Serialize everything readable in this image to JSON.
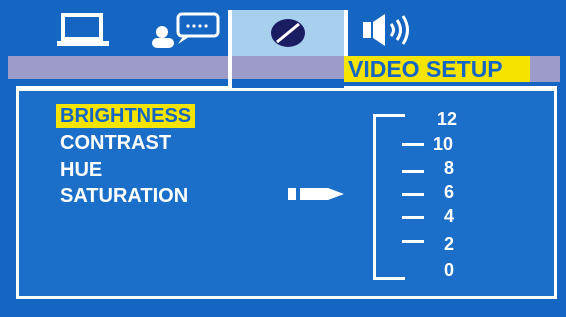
{
  "header": {
    "title": "VIDEO SETUP",
    "tabs": [
      {
        "icon": "monitor-icon"
      },
      {
        "icon": "user-chat-icon"
      },
      {
        "icon": "video-disc-icon",
        "selected": true
      },
      {
        "icon": "speaker-icon"
      }
    ]
  },
  "menu": {
    "items": [
      {
        "label": "BRIGHTNESS",
        "selected": true
      },
      {
        "label": "CONTRAST"
      },
      {
        "label": "HUE"
      },
      {
        "label": "SATURATION"
      }
    ]
  },
  "scale": {
    "labels": [
      "12",
      "10",
      "8",
      "6",
      "4",
      "2",
      "0"
    ]
  },
  "colors": {
    "background": "#1566c3",
    "highlight": "#f5e400",
    "header_bar": "#9d9cc8",
    "active_tab": "#a7d0ee",
    "text": "#ffffff"
  }
}
